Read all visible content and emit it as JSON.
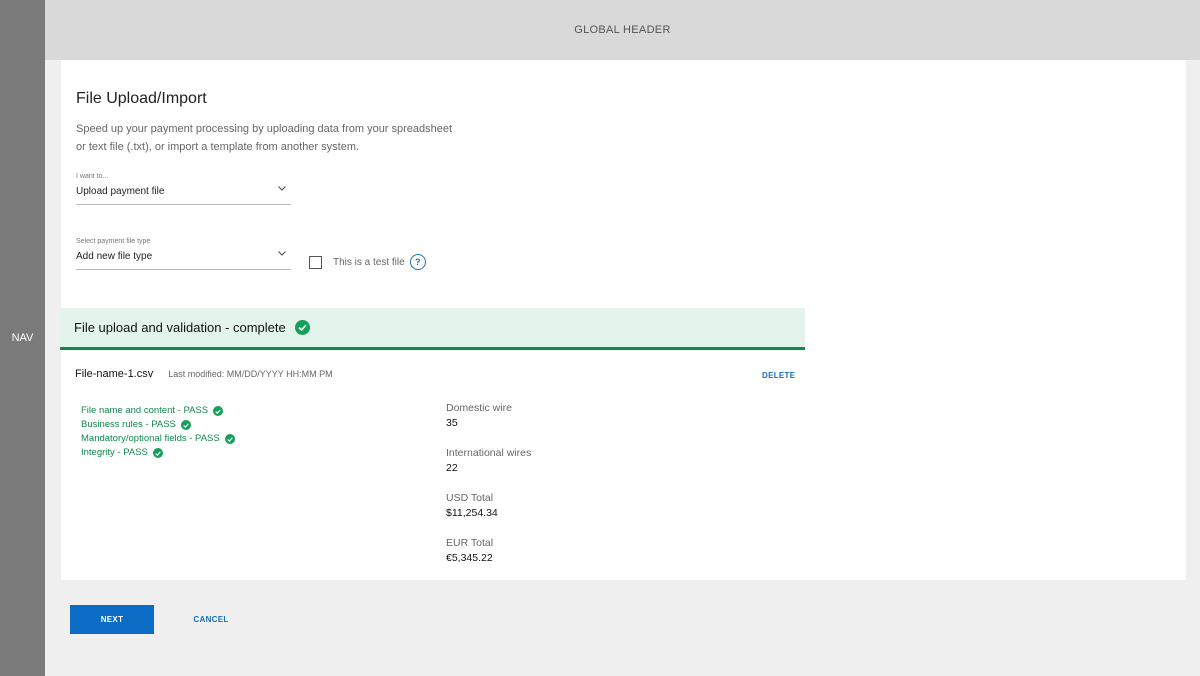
{
  "nav": {
    "label": "NAV"
  },
  "header": {
    "label": "GLOBAL HEADER"
  },
  "page": {
    "title": "File Upload/Import",
    "subtitle": "Speed up your payment processing by uploading data from your spreadsheet or text file (.txt), or import a template from another system."
  },
  "i_want_to": {
    "label": "I want to...",
    "value": "Upload payment file"
  },
  "file_type": {
    "label": "Select payment file type",
    "value": "Add new file type"
  },
  "test_file": {
    "label": "This is a test file",
    "checked": false,
    "help_icon": "question-icon"
  },
  "banner": {
    "title": "File upload and validation - complete",
    "icon": "check-circle-icon",
    "color": "#0f8a4f",
    "bg": "#e2f4ec"
  },
  "file": {
    "name": "File-name-1.csv",
    "modified": "Last modified: MM/DD/YYYY  HH:MM PM",
    "delete_label": "DELETE"
  },
  "checks": [
    {
      "label": "File name and content - PASS"
    },
    {
      "label": "Business rules - PASS"
    },
    {
      "label": "Mandatory/optional fields - PASS"
    },
    {
      "label": "Integrity - PASS"
    }
  ],
  "stats": [
    {
      "label": "Domestic wire",
      "value": "35"
    },
    {
      "label": "International wires",
      "value": "22"
    },
    {
      "label": "USD Total",
      "value": "$11,254.34"
    },
    {
      "label": "EUR Total",
      "value": "€5,345.22"
    }
  ],
  "actions": {
    "next_label": "NEXT",
    "cancel_label": "CANCEL"
  },
  "colors": {
    "primary": "#0a6cc4",
    "success": "#12a05a"
  }
}
